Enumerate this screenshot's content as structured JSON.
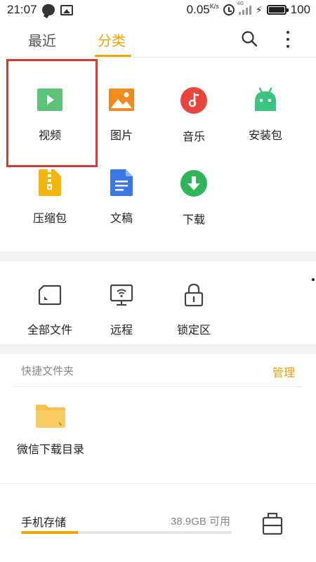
{
  "status_bar": {
    "time": "21:07",
    "speed": "0.05",
    "speed_unit": "K/s",
    "network_type": "4G",
    "battery_pct": "100"
  },
  "tabs": [
    {
      "label": "最近",
      "active": false
    },
    {
      "label": "分类",
      "active": true
    }
  ],
  "categories": [
    {
      "label": "视频",
      "icon": "video-icon",
      "color": "#5cc27a"
    },
    {
      "label": "图片",
      "icon": "image-icon",
      "color": "#f38a1e"
    },
    {
      "label": "音乐",
      "icon": "music-icon",
      "color": "#e8453c"
    },
    {
      "label": "安装包",
      "icon": "android-icon",
      "color": "#3cc281"
    },
    {
      "label": "压缩包",
      "icon": "zip-icon",
      "color": "#f5b60b"
    },
    {
      "label": "文稿",
      "icon": "document-icon",
      "color": "#3b78e7"
    },
    {
      "label": "下载",
      "icon": "download-icon",
      "color": "#2fb55a"
    }
  ],
  "tools": [
    {
      "label": "全部文件",
      "icon": "sd-card-icon"
    },
    {
      "label": "远程",
      "icon": "remote-monitor-icon"
    },
    {
      "label": "锁定区",
      "icon": "lock-icon"
    }
  ],
  "quick_folders": {
    "title": "快捷文件夹",
    "manage_label": "管理",
    "items": [
      {
        "label": "微信下载目录",
        "icon": "folder-icon",
        "color": "#f7c04a"
      }
    ]
  },
  "storage": {
    "label": "手机存储",
    "free": "38.9GB 可用",
    "used_fraction": 0.27,
    "accent": "#f0a500"
  },
  "colors": {
    "accent": "#f0a500",
    "highlight": "#d33b32"
  }
}
